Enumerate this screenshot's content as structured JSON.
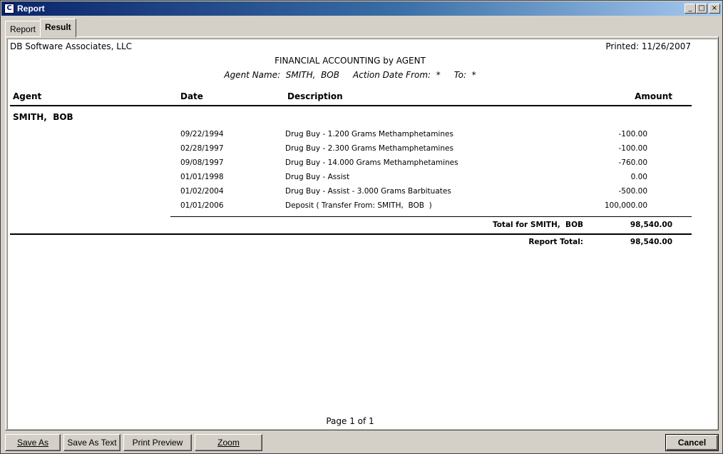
{
  "window": {
    "title": "Report",
    "icon": "app-icon"
  },
  "tabs": [
    {
      "label": "Report"
    },
    {
      "label": "Result"
    }
  ],
  "report": {
    "company": "DB Software Associates, LLC",
    "printed": "Printed: 11/26/2007",
    "title": "FINANCIAL ACCOUNTING by AGENT",
    "subtitle": "Agent Name:  SMITH,  BOB     Action Date From:  *     To:  *",
    "headers": {
      "agent": "Agent",
      "date": "Date",
      "description": "Description",
      "amount": "Amount"
    },
    "agent_name": "SMITH,  BOB",
    "rows": [
      {
        "date": "09/22/1994",
        "description": "Drug Buy - 1.200 Grams Methamphetamines",
        "amount": "-100.00"
      },
      {
        "date": "02/28/1997",
        "description": "Drug Buy - 2.300 Grams Methamphetamines",
        "amount": "-100.00"
      },
      {
        "date": "09/08/1997",
        "description": "Drug Buy - 14.000 Grams Methamphetamines",
        "amount": "-760.00"
      },
      {
        "date": "01/01/1998",
        "description": "Drug Buy - Assist",
        "amount": "0.00"
      },
      {
        "date": "01/02/2004",
        "description": "Drug Buy - Assist - 3.000 Grams Barbituates",
        "amount": "-500.00"
      },
      {
        "date": "01/01/2006",
        "description": "Deposit ( Transfer From: SMITH,  BOB  )",
        "amount": "100,000.00"
      }
    ],
    "subtotal_label": "Total for SMITH,  BOB",
    "subtotal_value": "98,540.00",
    "total_label": "Report Total:",
    "total_value": "98,540.00",
    "page": "Page 1 of 1"
  },
  "buttons": {
    "save_as": "Save As",
    "save_as_text": "Save As Text",
    "print_preview": "Print Preview",
    "zoom": "Zoom",
    "cancel": "Cancel"
  }
}
